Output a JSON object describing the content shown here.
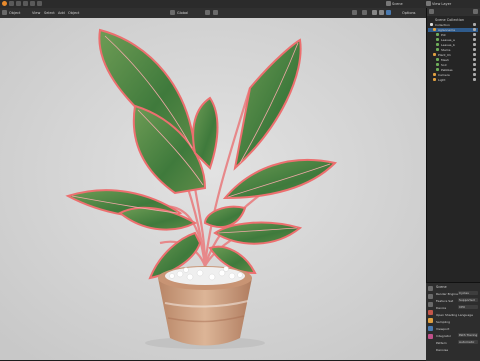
{
  "topbar": {
    "scene_label": "Scene",
    "view_layer_label": "View Layer"
  },
  "viewport_header": {
    "mode": "Object",
    "view_menu": "View",
    "select_menu": "Select",
    "add_menu": "Add",
    "object_menu": "Object",
    "shading": "Global",
    "options": "Options"
  },
  "viewport_overlay": {
    "view_name": "User Perspective",
    "collection": "(1) Collection"
  },
  "outliner": {
    "title": "Scene Collection",
    "items": [
      {
        "label": "Collection",
        "depth": 0,
        "selected": false
      },
      {
        "label": "Aglaonema",
        "depth": 1,
        "selected": true
      },
      {
        "label": "Pot",
        "depth": 2,
        "selected": false
      },
      {
        "label": "Leaves_a",
        "depth": 2,
        "selected": false
      },
      {
        "label": "Leaves_b",
        "depth": 2,
        "selected": false
      },
      {
        "label": "Stems",
        "depth": 2,
        "selected": false
      },
      {
        "label": "Plant_01",
        "depth": 1,
        "selected": false
      },
      {
        "label": "Mesh",
        "depth": 2,
        "selected": false
      },
      {
        "label": "Soil",
        "depth": 2,
        "selected": false
      },
      {
        "label": "Pebbles",
        "depth": 2,
        "selected": false
      },
      {
        "label": "Camera",
        "depth": 1,
        "selected": false
      },
      {
        "label": "Light",
        "depth": 1,
        "selected": false
      }
    ]
  },
  "properties": {
    "title": "Scene",
    "rows": [
      {
        "label": "Render Engine",
        "value": "Cycles"
      },
      {
        "label": "Feature Set",
        "value": "Supported"
      },
      {
        "label": "Device",
        "value": "CPU"
      },
      {
        "label": "Open Shading Language",
        "value": ""
      },
      {
        "label": "Sampling",
        "value": ""
      },
      {
        "label": "Viewport",
        "value": ""
      },
      {
        "label": "Integrator",
        "value": "Path Tracing"
      },
      {
        "label": "Pattern",
        "value": "Automatic"
      },
      {
        "label": "Denoise",
        "value": ""
      }
    ]
  },
  "colors": {
    "leaf_green": "#4f8a43",
    "leaf_edge": "#e46a6a",
    "pot": "#c99b78",
    "background": "#d4d4d4"
  }
}
